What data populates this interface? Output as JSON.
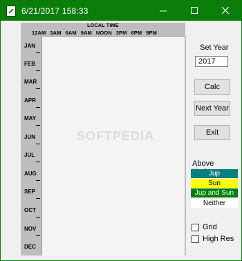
{
  "window": {
    "title": "6/21/2017  158:33",
    "minimize_glyph": "—",
    "maximize_glyph": "☐",
    "close_glyph": "✕"
  },
  "plot": {
    "header": "LOCAL TIME",
    "hours": [
      "12AM",
      "3AM",
      "6AM",
      "9AM",
      "NOON",
      "3PM",
      "6PM",
      "9PM"
    ],
    "months": [
      "JAN",
      "FEB",
      "MAR",
      "APR",
      "MAY",
      "JUN",
      "JUL",
      "AUG",
      "SEP",
      "OCT",
      "NOV",
      "DEC"
    ],
    "watermark": "SOFTPEDIA"
  },
  "controls": {
    "set_year_label": "Set Year",
    "year_value": "2017",
    "calc_label": "Calc",
    "next_year_label": "Next Year",
    "exit_label": "Exit"
  },
  "legend": {
    "title": "Above Horizon",
    "items": [
      {
        "label": "Jup",
        "color": "#0a7f7f"
      },
      {
        "label": "Sun",
        "color": "#ffff00"
      },
      {
        "label": "Jup and Sun",
        "color": "#008000"
      },
      {
        "label": "Neither",
        "color": "#ffffff"
      }
    ]
  },
  "options": {
    "grid_label": "Grid",
    "grid_checked": false,
    "hires_label": "High Res",
    "hires_checked": false
  }
}
